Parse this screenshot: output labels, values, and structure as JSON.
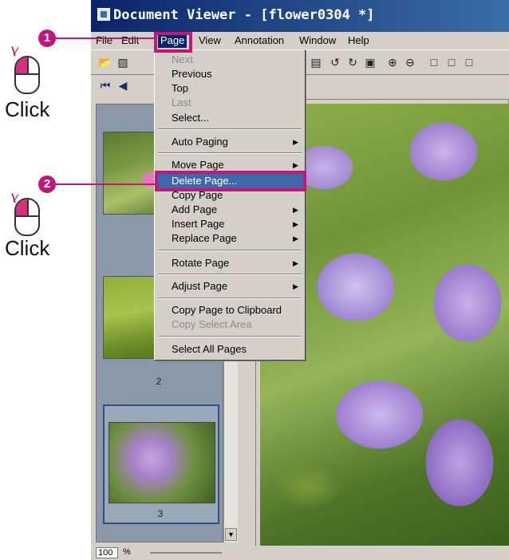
{
  "window": {
    "title": "Document Viewer - [flower0304 *]"
  },
  "menubar": [
    {
      "label": "File"
    },
    {
      "label": "Edit"
    },
    {
      "label": "Page"
    },
    {
      "label": "View"
    },
    {
      "label": "Annotation"
    },
    {
      "label": "Window"
    },
    {
      "label": "Help"
    }
  ],
  "page_menu": {
    "items": [
      {
        "label": "Next",
        "enabled": false
      },
      {
        "label": "Previous",
        "enabled": true
      },
      {
        "label": "Top",
        "enabled": true
      },
      {
        "label": "Last",
        "enabled": false
      },
      {
        "label": "Select...",
        "enabled": true
      },
      {
        "label": "Auto Paging",
        "enabled": true,
        "submenu": true
      },
      {
        "label": "Move Page",
        "enabled": true,
        "submenu": true
      },
      {
        "label": "Delete Page...",
        "enabled": true,
        "selected": true
      },
      {
        "label": "Copy Page",
        "enabled": true
      },
      {
        "label": "Add Page",
        "enabled": true,
        "submenu": true
      },
      {
        "label": "Insert Page",
        "enabled": true,
        "submenu": true
      },
      {
        "label": "Replace Page",
        "enabled": true,
        "submenu": true
      },
      {
        "label": "Rotate Page",
        "enabled": true,
        "submenu": true
      },
      {
        "label": "Adjust Page",
        "enabled": true,
        "submenu": true
      },
      {
        "label": "Copy Page to Clipboard",
        "enabled": true
      },
      {
        "label": "Copy Select Area",
        "enabled": false
      },
      {
        "label": "Select All Pages",
        "enabled": true
      }
    ]
  },
  "thumbnails": {
    "pages": [
      {
        "number": "2"
      },
      {
        "number": "3"
      }
    ]
  },
  "statusbar": {
    "zoom_value": "100",
    "zoom_unit": "%"
  },
  "annotations": {
    "step1": "1",
    "step2": "2",
    "click_label_1": "Click",
    "click_label_2": "Click",
    "highlight_color": "#c2177a"
  },
  "icons": {
    "title": "document-viewer-app-icon",
    "toolbar": [
      "open-folder-icon",
      "save-icon",
      "page-icon",
      "rotate-left-icon",
      "rotate-right-icon",
      "page-fit-icon",
      "zoom-in-icon",
      "zoom-out-icon",
      "single-page-icon",
      "two-page-icon",
      "thumbnail-view-icon"
    ],
    "nav": [
      "first-page-icon",
      "previous-page-icon"
    ]
  }
}
